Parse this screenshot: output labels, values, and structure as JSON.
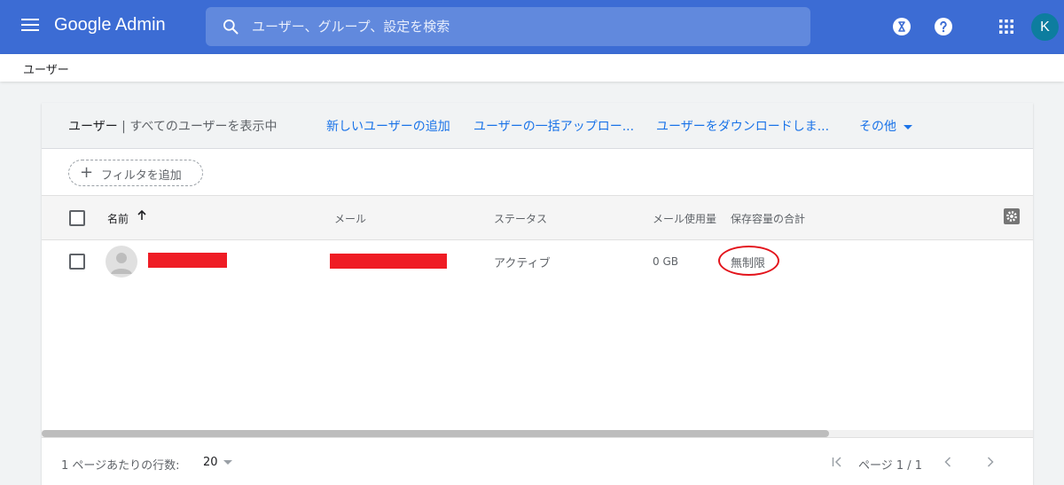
{
  "header": {
    "brand": "Google Admin",
    "search_placeholder": "ユーザー、グループ、設定を検索",
    "account_initial": "K"
  },
  "breadcrumb": "ユーザー",
  "toolbar": {
    "title": "ユーザー",
    "separator": " | ",
    "subtitle": "すべてのユーザーを表示中",
    "add_user": "新しいユーザーの追加",
    "bulk_upload": "ユーザーの一括アップロー...",
    "download": "ユーザーをダウンロードしま...",
    "more": "その他"
  },
  "filter": {
    "plus": "+",
    "label": "フィルタを追加"
  },
  "table": {
    "columns": {
      "name": "名前",
      "email": "メール",
      "status": "ステータス",
      "mail_usage": "メール使用量",
      "storage_total": "保存容量の合計"
    },
    "rows": [
      {
        "status": "アクティブ",
        "mail_usage": "0 GB",
        "storage": "無制限"
      }
    ]
  },
  "footer": {
    "rows_per_page_label": "1 ページあたりの行数:",
    "rows_per_page_value": "20",
    "page_indicator": "ページ 1 / 1"
  },
  "icons": {
    "menu": "menu-icon",
    "search": "search-icon",
    "hourglass": "hourglass-icon",
    "help": "help-icon",
    "apps": "apps-grid-icon",
    "sort": "arrow-up-icon",
    "settings": "settings-gear-icon"
  },
  "colors": {
    "topbar": "#3c6cd4",
    "search_bg": "#6189dd",
    "link": "#1a73e8",
    "redaction": "#ef1c24",
    "avatar": "#0d7d9f"
  }
}
